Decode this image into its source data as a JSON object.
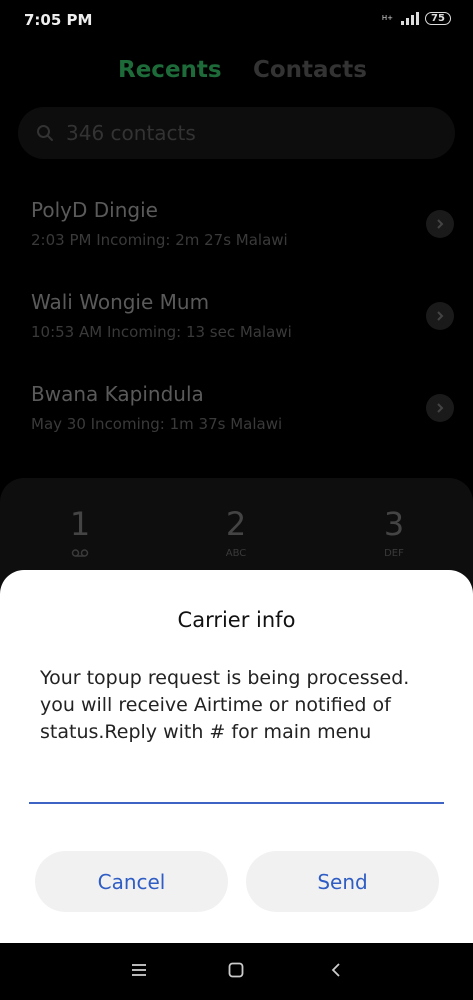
{
  "status_bar": {
    "time": "7:05 PM",
    "network": "H+",
    "battery": "75"
  },
  "tabs": [
    {
      "label": "Recents",
      "active": true
    },
    {
      "label": "Contacts",
      "active": false
    }
  ],
  "search": {
    "placeholder": "346 contacts",
    "icon": "search-icon"
  },
  "calls": [
    {
      "name": "PolyD Dingie",
      "detail": "2:03 PM Incoming: 2m 27s Malawi"
    },
    {
      "name": "Wali Wongie Mum",
      "detail": "10:53 AM Incoming: 13 sec Malawi"
    },
    {
      "name": "Bwana Kapindula",
      "detail": "May 30 Incoming: 1m 37s Malawi"
    }
  ],
  "dialpad": {
    "keys": [
      {
        "num": "1",
        "sub": "voicemail-icon"
      },
      {
        "num": "2",
        "sub": "ABC"
      },
      {
        "num": "3",
        "sub": "DEF"
      }
    ]
  },
  "dialog": {
    "title": "Carrier info",
    "message": "Your topup request is being processed. you will receive Airtime or notified of status.Reply with # for main menu",
    "input_value": "",
    "cancel_label": "Cancel",
    "send_label": "Send"
  },
  "colors": {
    "accent_blue": "#2f5dc4",
    "recents_green": "#1e6b3a"
  }
}
